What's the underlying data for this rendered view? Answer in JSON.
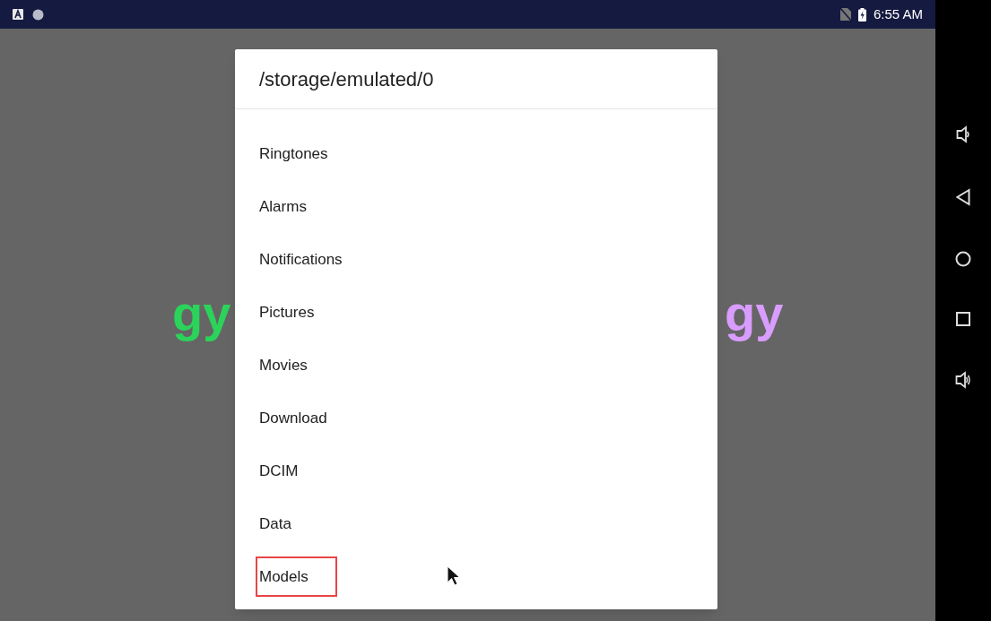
{
  "status_bar": {
    "time": "6:55 AM"
  },
  "background_text": [
    {
      "text": "gy",
      "color": "#2bd35a"
    },
    {
      "text": "gy",
      "color": "#d99cff"
    }
  ],
  "dialog": {
    "title": "/storage/emulated/0",
    "items": [
      {
        "label": "Ringtones",
        "highlighted": false
      },
      {
        "label": "Alarms",
        "highlighted": false
      },
      {
        "label": "Notifications",
        "highlighted": false
      },
      {
        "label": "Pictures",
        "highlighted": false
      },
      {
        "label": "Movies",
        "highlighted": false
      },
      {
        "label": "Download",
        "highlighted": false
      },
      {
        "label": "DCIM",
        "highlighted": false
      },
      {
        "label": "Data",
        "highlighted": false
      },
      {
        "label": "Models",
        "highlighted": true
      }
    ]
  }
}
